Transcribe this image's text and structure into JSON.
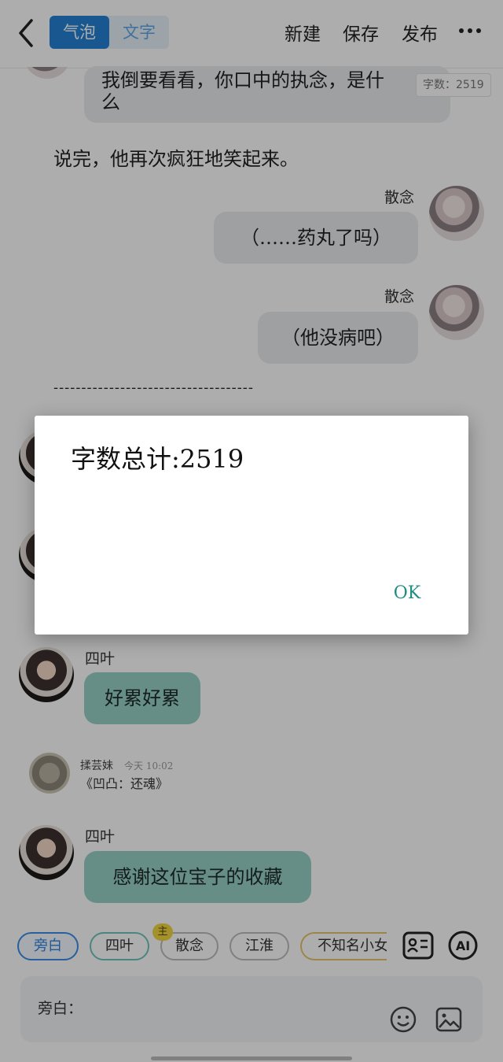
{
  "header": {
    "tab_bubble": "气泡",
    "tab_text": "文字",
    "new_label": "新建",
    "save_label": "保存",
    "publish_label": "发布"
  },
  "chat": {
    "top_bubble_line1": "我倒要看看，你口中的执念，是什",
    "top_bubble_line2": "么",
    "word_count_badge": "字数：2519",
    "narration1": "说完，他再次疯狂地笑起来。",
    "msg1_name": "散念",
    "msg1_text": "（……药丸了吗）",
    "msg2_name": "散念",
    "msg2_text": "（他没病吧）",
    "divider": "------------------------------------",
    "msg3_name": "四叶",
    "msg3_text": "好累好累",
    "card_user": "揉芸妹",
    "card_meta": "今天 10:02",
    "card_title": "《凹凸：还魂》",
    "msg4_name": "四叶",
    "msg4_text": "感谢这位宝子的收藏"
  },
  "dialog": {
    "message": "字数总计:2519",
    "ok_label": "OK"
  },
  "roles": {
    "items": [
      "旁白",
      "四叶",
      "散念",
      "江淮",
      "不知名小女"
    ],
    "main_marker": "主"
  },
  "input": {
    "label": "旁白："
  },
  "colors": {
    "accent_blue": "#2480d4",
    "teal_bubble": "#97d1c8",
    "ok_teal": "#1f8c84"
  }
}
